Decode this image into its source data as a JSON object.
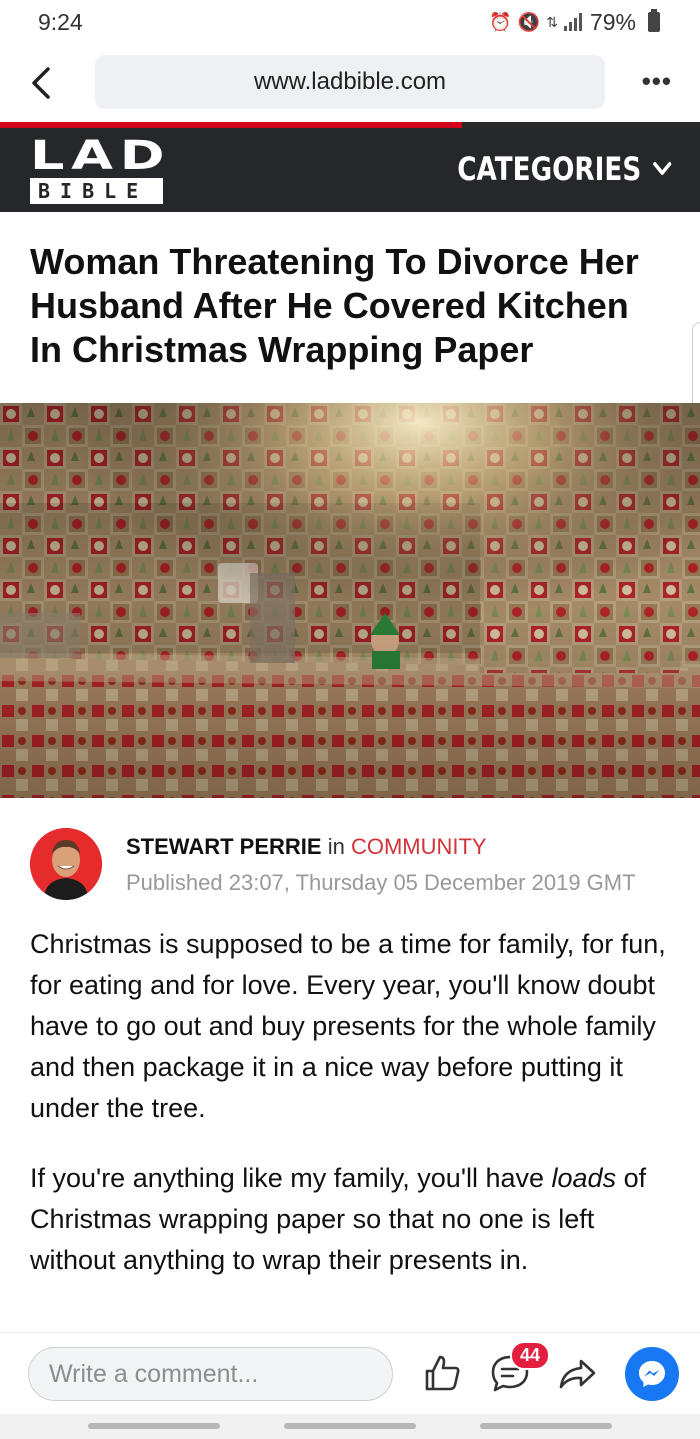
{
  "status_bar": {
    "time": "9:24",
    "battery": "79%",
    "icons": [
      "alarm-icon",
      "mute-icon",
      "data-icon",
      "signal-icon",
      "battery-icon"
    ]
  },
  "browser": {
    "url": "www.ladbible.com",
    "back_icon": "back-chevron-icon",
    "menu_label": "•••",
    "load_progress": 0.66,
    "accent": "#d0021b"
  },
  "site_header": {
    "logo_top": "LAD",
    "logo_bottom": "BIBLE",
    "categories_label": "CATEGORIES",
    "background": "#26272b"
  },
  "article": {
    "headline": "Woman Threatening To Divorce Her Husband After He Covered Kitchen In Christmas Wrapping Paper",
    "author": "STEWART PERRIE",
    "in_word": "in",
    "category": "COMMUNITY",
    "published": "Published 23:07, Thursday 05 December 2019 GMT",
    "paragraph1": "Christmas is supposed to be a time for family, for fun, for eating and for love. Every year, you'll know doubt have to go out and buy presents for the whole family and then package it in a nice way before putting it under the tree.",
    "paragraph2_before": "If you're anything like my family, you'll have ",
    "paragraph2_em": "loads",
    "paragraph2_after": " of Christmas wrapping paper so that no one is left without anything to wrap their presents in."
  },
  "comment_bar": {
    "placeholder": "Write a comment...",
    "comment_count": "44",
    "icons": [
      "like-icon",
      "comment-icon",
      "share-icon",
      "messenger-icon"
    ]
  }
}
